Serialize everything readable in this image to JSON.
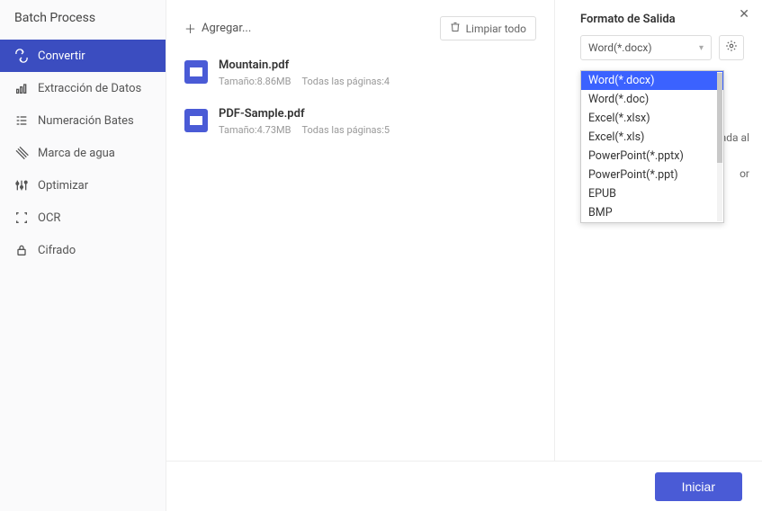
{
  "window": {
    "title": "Batch Process"
  },
  "sidebar": {
    "items": [
      {
        "label": "Convertir",
        "active": true
      },
      {
        "label": "Extracción de Datos"
      },
      {
        "label": "Numeración Bates"
      },
      {
        "label": "Marca de agua"
      },
      {
        "label": "Optimizar"
      },
      {
        "label": "OCR"
      },
      {
        "label": "Cifrado"
      }
    ]
  },
  "toolbar": {
    "add_label": "Agregar...",
    "clear_label": "Limpiar todo"
  },
  "files": [
    {
      "name": "Mountain.pdf",
      "size": "Tamaño:8.86MB",
      "pages": "Todas las páginas:4"
    },
    {
      "name": "PDF-Sample.pdf",
      "size": "Tamaño:4.73MB",
      "pages": "Todas las páginas:5"
    }
  ],
  "output": {
    "title": "Formato de Salida",
    "selected": "Word(*.docx)",
    "options": [
      "Word(*.docx)",
      "Word(*.doc)",
      "Excel(*.xlsx)",
      "Excel(*.xls)",
      "PowerPoint(*.pptx)",
      "PowerPoint(*.ppt)",
      "EPUB",
      "BMP"
    ],
    "hidden_text_frag1": "ada al",
    "hidden_text_frag2": "or"
  },
  "footer": {
    "start_label": "Iniciar"
  }
}
